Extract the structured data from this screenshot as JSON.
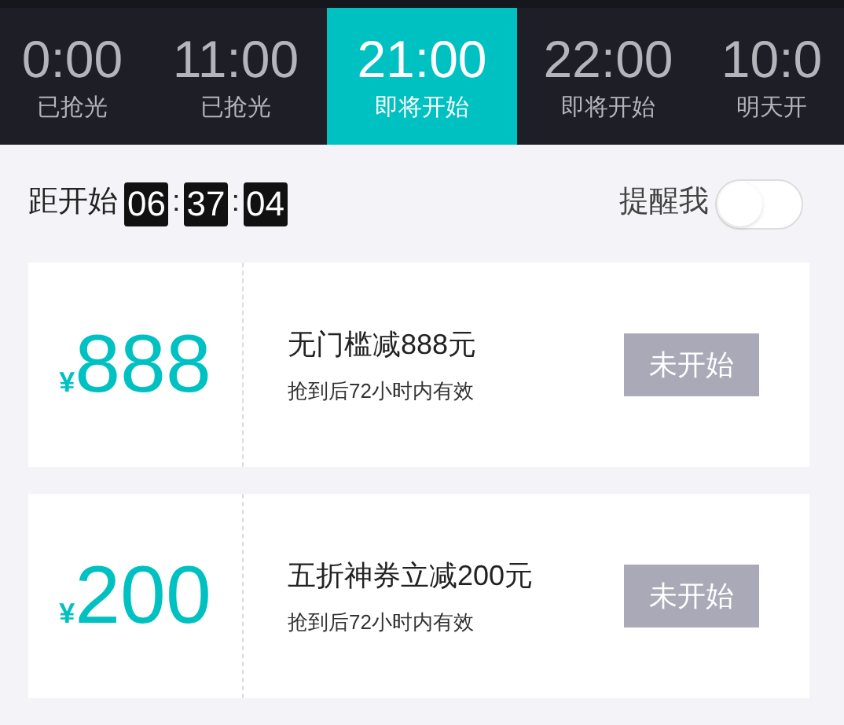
{
  "tabs": [
    {
      "time": "0:00",
      "status": "已抢光",
      "selected": false
    },
    {
      "time": "11:00",
      "status": "已抢光",
      "selected": false
    },
    {
      "time": "21:00",
      "status": "即将开始",
      "selected": true
    },
    {
      "time": "22:00",
      "status": "即将开始",
      "selected": false
    },
    {
      "time": "10:0",
      "status": "明天开",
      "selected": false
    }
  ],
  "countdown": {
    "label": "距开始",
    "hours": "06",
    "separator_1": ":",
    "minutes": "37",
    "separator_2": ":",
    "seconds": "04"
  },
  "reminder": {
    "label": "提醒我",
    "on": false
  },
  "coupons": [
    {
      "currency": "¥",
      "amount": "888",
      "title": "无门槛减888元",
      "note": "抢到后72小时内有效",
      "button": "未开始",
      "disabled": true
    },
    {
      "currency": "¥",
      "amount": "200",
      "title": "五折神券立减200元",
      "note": "抢到后72小时内有效",
      "button": "未开始",
      "disabled": true
    }
  ]
}
